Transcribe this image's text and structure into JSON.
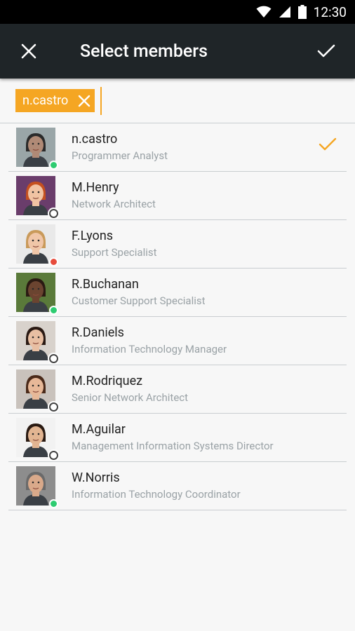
{
  "status": {
    "time": "12:30"
  },
  "appbar": {
    "title": "Select members"
  },
  "chips": [
    {
      "label": "n.castro"
    }
  ],
  "colors": {
    "accent": "#f5a623",
    "appbar": "#1f2528",
    "online": "#2ecc71",
    "busy": "#e74c3c"
  },
  "members": [
    {
      "name": "n.castro",
      "role": "Programmer Analyst",
      "presence": "online",
      "selected": true,
      "skin": "#b08a76",
      "hair": "#2a2a2a",
      "bg": "#9aa6a8"
    },
    {
      "name": "M.Henry",
      "role": "Network Architect",
      "presence": "offline",
      "selected": false,
      "skin": "#f1c3a3",
      "hair": "#c5501f",
      "bg": "#6a3d6b"
    },
    {
      "name": "F.Lyons",
      "role": "Support Specialist",
      "presence": "busy",
      "selected": false,
      "skin": "#f0c6a8",
      "hair": "#c99a5a",
      "bg": "#e9e9e9"
    },
    {
      "name": "R.Buchanan",
      "role": "Customer Support Specialist",
      "presence": "online",
      "selected": false,
      "skin": "#6b4430",
      "hair": "#2a1a12",
      "bg": "#5a7a3a"
    },
    {
      "name": "R.Daniels",
      "role": "Information Technology Manager",
      "presence": "offline",
      "selected": false,
      "skin": "#e8bfa3",
      "hair": "#2a1a14",
      "bg": "#d8d2cc"
    },
    {
      "name": "M.Rodriquez",
      "role": "Senior Network Architect",
      "presence": "offline",
      "selected": false,
      "skin": "#e7b898",
      "hair": "#4a2a1a",
      "bg": "#c9c2bc"
    },
    {
      "name": "M.Aguilar",
      "role": "Management Information Systems Director",
      "presence": "offline",
      "selected": false,
      "skin": "#e2b592",
      "hair": "#2a1a12",
      "bg": "#f2f2f2"
    },
    {
      "name": "W.Norris",
      "role": "Information Technology Coordinator",
      "presence": "online",
      "selected": false,
      "skin": "#d9a98a",
      "hair": "#6a6a6a",
      "bg": "#8d8d8d"
    }
  ]
}
